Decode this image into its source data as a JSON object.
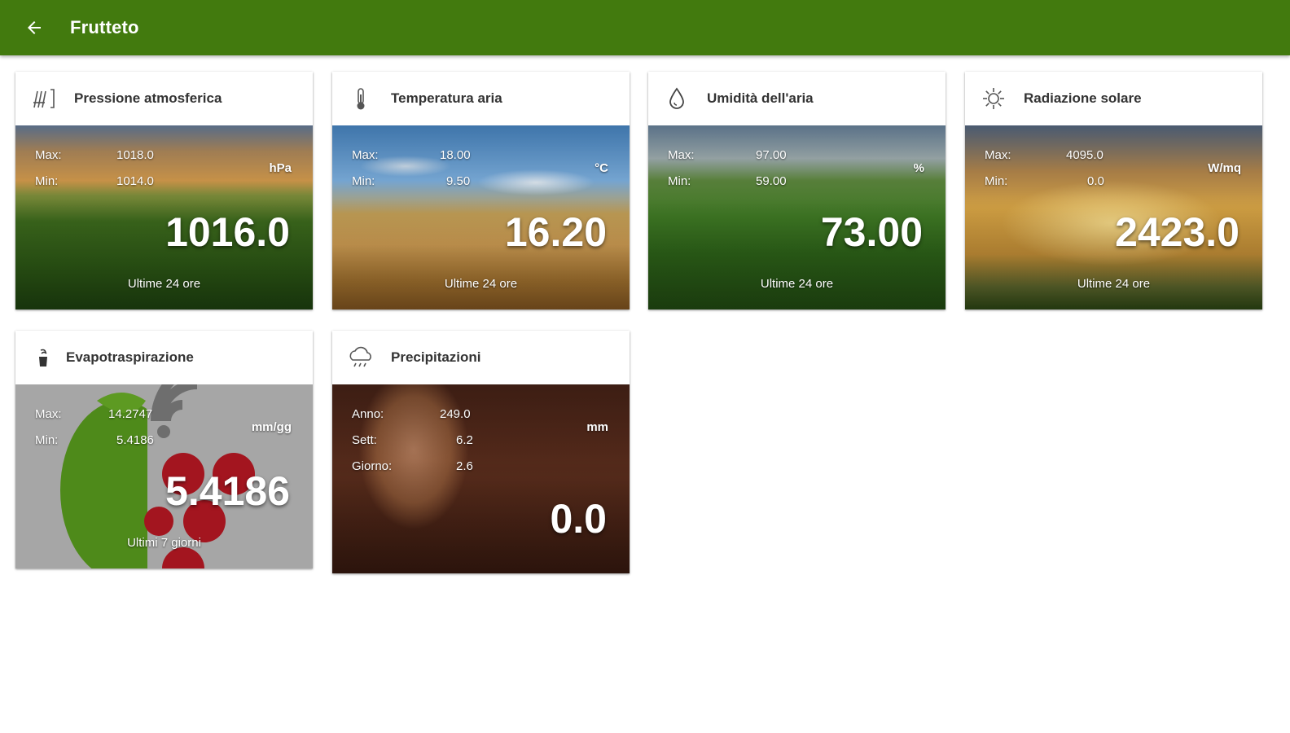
{
  "appbar": {
    "title": "Frutteto"
  },
  "cards": [
    {
      "title": "Pressione atmosferica",
      "icon": "pressure-icon",
      "rows": [
        {
          "label": "Max:",
          "value": "1018.0"
        },
        {
          "label": "Min:",
          "value": "1014.0"
        }
      ],
      "unit": "hPa",
      "value": "1016.0",
      "caption": "Ultime 24 ore"
    },
    {
      "title": "Temperatura aria",
      "icon": "thermometer-icon",
      "rows": [
        {
          "label": "Max:",
          "value": "18.00"
        },
        {
          "label": "Min:",
          "value": "9.50"
        }
      ],
      "unit": "°C",
      "value": "16.20",
      "caption": "Ultime 24 ore"
    },
    {
      "title": "Umidità dell'aria",
      "icon": "water-drop-icon",
      "rows": [
        {
          "label": "Max:",
          "value": "97.00"
        },
        {
          "label": "Min:",
          "value": "59.00"
        }
      ],
      "unit": "%",
      "value": "73.00",
      "caption": "Ultime 24 ore"
    },
    {
      "title": "Radiazione solare",
      "icon": "sun-icon",
      "rows": [
        {
          "label": "Max:",
          "value": "4095.0"
        },
        {
          "label": "Min:",
          "value": "0.0"
        }
      ],
      "unit": "W/mq",
      "value": "2423.0",
      "caption": "Ultime 24 ore"
    },
    {
      "title": "Evapotraspirazione",
      "icon": "evapotranspiration-icon",
      "rows": [
        {
          "label": "Max:",
          "value": "14.2747"
        },
        {
          "label": "Min:",
          "value": "5.4186"
        }
      ],
      "unit": "mm/gg",
      "value": "5.4186",
      "caption": "Ultimi 7 giorni"
    },
    {
      "title": "Precipitazioni",
      "icon": "rain-cloud-icon",
      "rows": [
        {
          "label": "Anno:",
          "value": "249.0"
        },
        {
          "label": "Sett:",
          "value": "6.2"
        },
        {
          "label": "Giorno:",
          "value": "2.6"
        }
      ],
      "unit": "mm",
      "value": "0.0",
      "caption": ""
    }
  ]
}
